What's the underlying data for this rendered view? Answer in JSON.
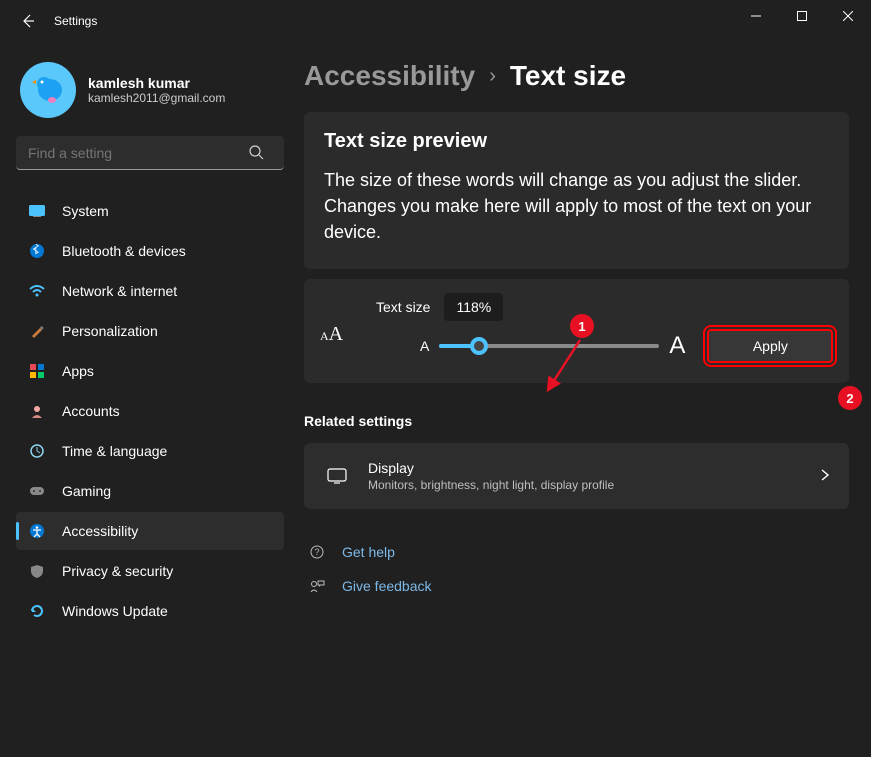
{
  "window": {
    "title": "Settings"
  },
  "user": {
    "name": "kamlesh kumar",
    "email": "kamlesh2011@gmail.com"
  },
  "search": {
    "placeholder": "Find a setting"
  },
  "sidebar": {
    "items": [
      {
        "label": "System"
      },
      {
        "label": "Bluetooth & devices"
      },
      {
        "label": "Network & internet"
      },
      {
        "label": "Personalization"
      },
      {
        "label": "Apps"
      },
      {
        "label": "Accounts"
      },
      {
        "label": "Time & language"
      },
      {
        "label": "Gaming"
      },
      {
        "label": "Accessibility"
      },
      {
        "label": "Privacy & security"
      },
      {
        "label": "Windows Update"
      }
    ]
  },
  "breadcrumb": {
    "parent": "Accessibility",
    "current": "Text size"
  },
  "preview": {
    "title": "Text size preview",
    "body": "The size of these words will change as you adjust the slider. Changes you make here will apply to most of the text on your device."
  },
  "slider": {
    "label": "Text size",
    "value": "118%",
    "apply": "Apply",
    "min_glyph": "A",
    "max_glyph": "A",
    "icon_glyph": "A​A"
  },
  "related": {
    "heading": "Related settings",
    "display": {
      "title": "Display",
      "sub": "Monitors, brightness, night light, display profile"
    }
  },
  "links": {
    "help": "Get help",
    "feedback": "Give feedback"
  },
  "annotations": {
    "one": "1",
    "two": "2"
  }
}
